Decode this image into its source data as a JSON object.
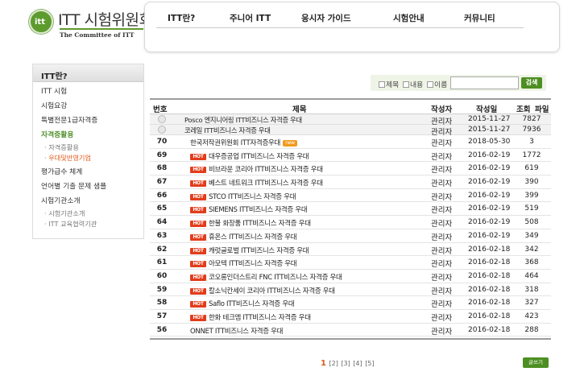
{
  "header": {
    "logo_main": "ITT 시험위원회",
    "logo_badge": "itt",
    "logo_sub": "The Committee of ITT"
  },
  "nav": {
    "items": [
      {
        "label": "ITT란?"
      },
      {
        "label": "주니어 ITT"
      },
      {
        "label": "응시자 가이드"
      },
      {
        "label": "시험안내"
      },
      {
        "label": "커뮤니티"
      }
    ]
  },
  "sidebar": {
    "title": "ITT란?",
    "items": [
      {
        "label": "ITT 시험"
      },
      {
        "label": "시험요강"
      },
      {
        "label": "특별전문1급자격증"
      },
      {
        "label": "자격증활용"
      },
      {
        "label": "· 자격증활용"
      },
      {
        "label": "· 우대및반영기업"
      },
      {
        "label": "평가급수 체계"
      },
      {
        "label": "언어별 기출 문제 샘플"
      },
      {
        "label": "시험기관소개"
      },
      {
        "label": "· 시험기관소개"
      },
      {
        "label": "· ITT 교육협력기관"
      }
    ]
  },
  "search": {
    "opt_title": "제목",
    "opt_content": "내용",
    "opt_name": "이름",
    "query": "",
    "button": "검색"
  },
  "table": {
    "headers": {
      "no": "번호",
      "title": "제목",
      "author": "작성자",
      "date": "작성일",
      "views": "조회",
      "file": "파일"
    },
    "rows": [
      {
        "no": "",
        "title": "Posco 엔지니어링 ITT비즈니스 자격증 우대",
        "author": "관리자",
        "date": "2015-11-27",
        "views": "7827",
        "tag": "notice"
      },
      {
        "no": "",
        "title": "코레일 ITT비즈니스 자격증 우대",
        "author": "관리자",
        "date": "2015-11-27",
        "views": "7936",
        "tag": "notice"
      },
      {
        "no": "70",
        "title": "한국저작권위원회 ITT자격증우대",
        "author": "관리자",
        "date": "2018-05-30",
        "views": "3",
        "tag": "new"
      },
      {
        "no": "69",
        "title": "대우증공업 ITT비즈니스 자격증 우대",
        "author": "관리자",
        "date": "2016-02-19",
        "views": "1772",
        "tag": "hot"
      },
      {
        "no": "68",
        "title": "비브라운 코리아 ITT비즈니스 자격증 우대",
        "author": "관리자",
        "date": "2016-02-19",
        "views": "619",
        "tag": "hot"
      },
      {
        "no": "67",
        "title": "베스트 네트워크 ITT비즈니스 자격증 우대",
        "author": "관리자",
        "date": "2016-02-19",
        "views": "390",
        "tag": "hot"
      },
      {
        "no": "66",
        "title": "STCO ITT비즈니스 자격증 우대",
        "author": "관리자",
        "date": "2016-02-19",
        "views": "399",
        "tag": "hot"
      },
      {
        "no": "65",
        "title": "SIEMENS ITT비즈니스 자격증 우대",
        "author": "관리자",
        "date": "2016-02-19",
        "views": "519",
        "tag": "hot"
      },
      {
        "no": "64",
        "title": "한불 화장품 ITT비즈니스 자격증 우대",
        "author": "관리자",
        "date": "2016-02-19",
        "views": "508",
        "tag": "hot"
      },
      {
        "no": "63",
        "title": "휴온스 ITT비즈니스 자격증 우대",
        "author": "관리자",
        "date": "2016-02-19",
        "views": "349",
        "tag": "hot"
      },
      {
        "no": "62",
        "title": "캐럿글로벌 ITT비즈니스 자격증 우대",
        "author": "관리자",
        "date": "2016-02-18",
        "views": "342",
        "tag": "hot"
      },
      {
        "no": "61",
        "title": "아모텍 ITT비즈니스 자격증 우대",
        "author": "관리자",
        "date": "2016-02-18",
        "views": "368",
        "tag": "hot"
      },
      {
        "no": "60",
        "title": "코오롱인더스트리 FNC ITT비즈니스 자격증 우대",
        "author": "관리자",
        "date": "2016-02-18",
        "views": "464",
        "tag": "hot"
      },
      {
        "no": "59",
        "title": "칼소닉칸세이 코리아 ITT비즈니스 자격증 우대",
        "author": "관리자",
        "date": "2016-02-18",
        "views": "318",
        "tag": "hot"
      },
      {
        "no": "58",
        "title": "Saflo ITT비즈니스 자격증 우대",
        "author": "관리자",
        "date": "2016-02-18",
        "views": "327",
        "tag": "hot"
      },
      {
        "no": "57",
        "title": "한화 테크엠 ITT비즈니스 자격증 우대",
        "author": "관리자",
        "date": "2016-02-18",
        "views": "423",
        "tag": "hot"
      },
      {
        "no": "56",
        "title": "ONNET ITT비즈니스 자격증 우대",
        "author": "관리자",
        "date": "2016-02-18",
        "views": "288",
        "tag": ""
      }
    ],
    "hot_label": "HOT",
    "new_label": "new"
  },
  "pager": {
    "pages": [
      "1",
      "[2]",
      "[3]",
      "[4]",
      "[5]"
    ],
    "current": "1"
  },
  "write_button": "글쓰기",
  "colors": {
    "accent": "#4d8f22",
    "hot": "#e23d1b",
    "current": "#e05a1a"
  }
}
